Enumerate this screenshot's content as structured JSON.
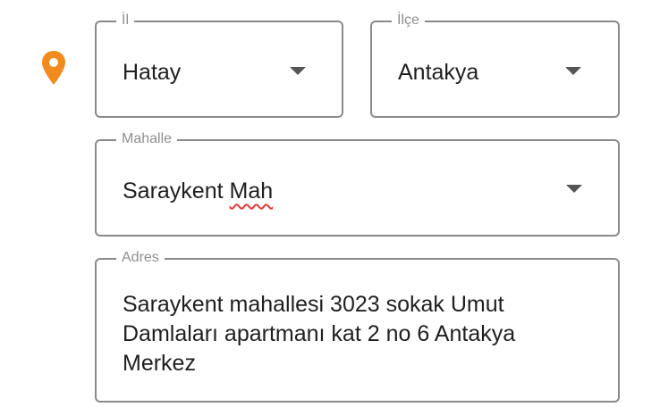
{
  "address_form": {
    "icon": "location-pin-icon",
    "accent_color": "#f28a1e",
    "province": {
      "label": "İl",
      "value": "Hatay"
    },
    "district": {
      "label": "İlçe",
      "value": "Antakya"
    },
    "neighborhood": {
      "label": "Mahalle",
      "value_main": "Saraykent ",
      "value_misspelled": "Mah"
    },
    "address": {
      "label": "Adres",
      "value": "Saraykent mahallesi 3023 sokak Umut\nDamlaları apartmanı kat 2 no 6 Antakya\nMerkez"
    }
  }
}
